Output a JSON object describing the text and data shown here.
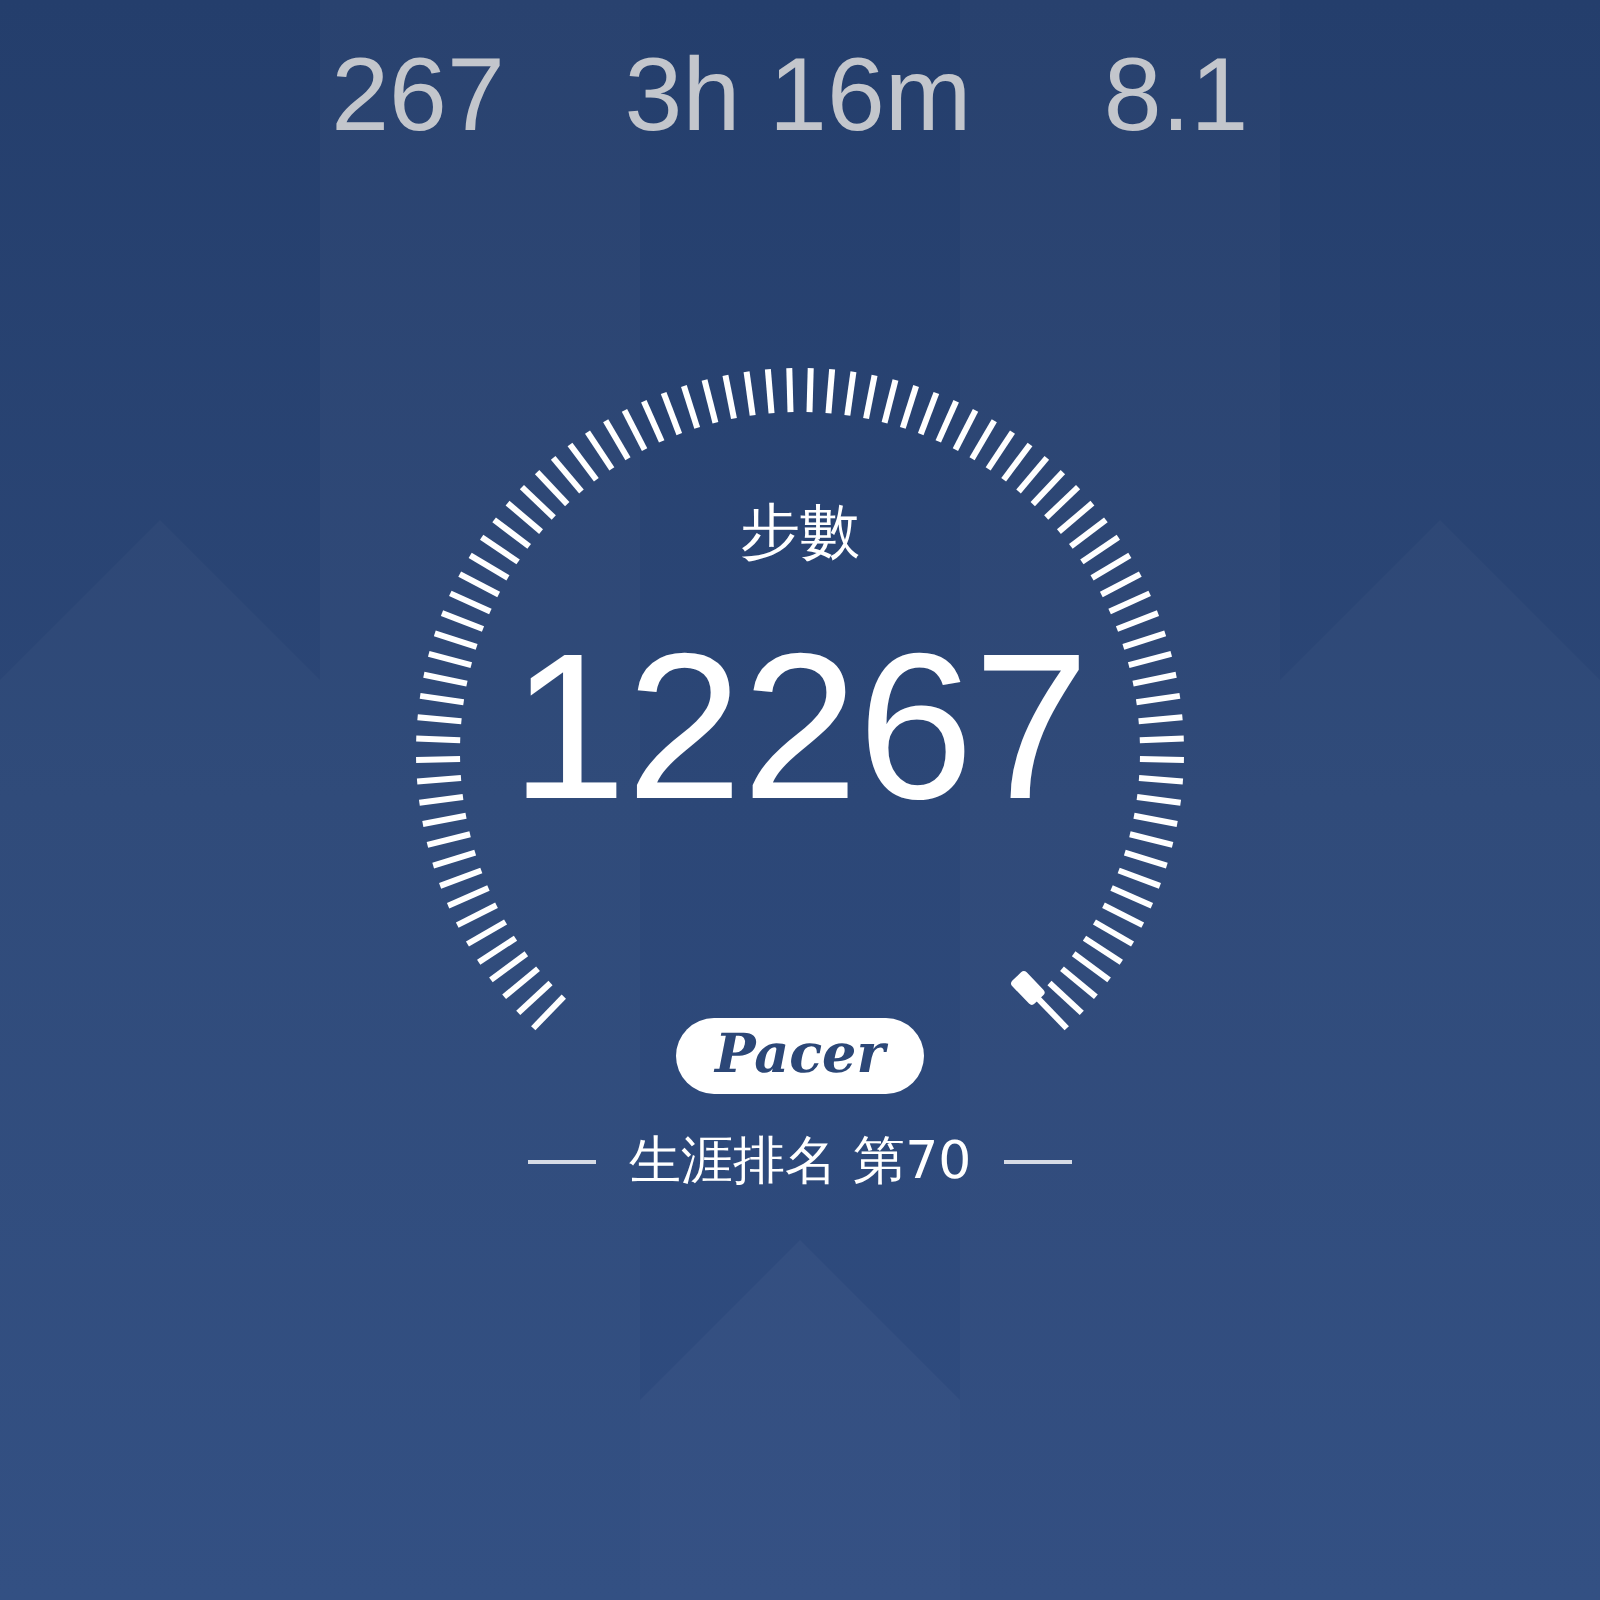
{
  "stats": [
    {
      "value": "267"
    },
    {
      "value": "3h 16m"
    },
    {
      "value": "8.1"
    }
  ],
  "gauge": {
    "label": "步數",
    "value": "12267"
  },
  "badge": "Pacer",
  "ranking": "生涯排名 第70"
}
